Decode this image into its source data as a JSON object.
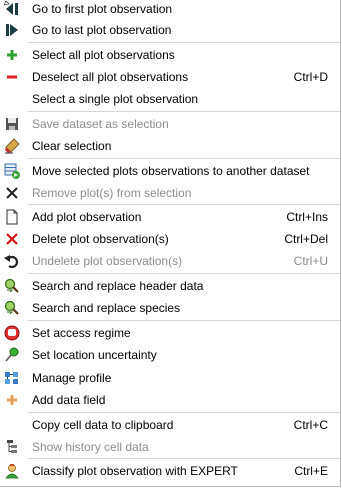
{
  "menu": {
    "items": [
      {
        "label": "Go to first plot observation",
        "shortcut": "",
        "enabled": true,
        "icon": "first-record-icon"
      },
      {
        "label": "Go to last plot observation",
        "shortcut": "",
        "enabled": true,
        "icon": "last-record-icon"
      },
      {
        "label": "Select all plot observations",
        "shortcut": "",
        "enabled": true,
        "icon": "plus-icon"
      },
      {
        "label": "Deselect all plot observations",
        "shortcut": "Ctrl+D",
        "enabled": true,
        "icon": "minus-icon"
      },
      {
        "label": "Select a single plot observation",
        "shortcut": "",
        "enabled": true,
        "icon": ""
      },
      {
        "label": "Save dataset as selection",
        "shortcut": "",
        "enabled": false,
        "icon": "save-icon"
      },
      {
        "label": "Clear selection",
        "shortcut": "",
        "enabled": true,
        "icon": "eraser-icon"
      },
      {
        "label": "Move selected plots observations to another dataset",
        "shortcut": "",
        "enabled": true,
        "icon": "move-dataset-icon"
      },
      {
        "label": "Remove plot(s) from selection",
        "shortcut": "",
        "enabled": false,
        "icon": "remove-x-icon"
      },
      {
        "label": "Add plot observation",
        "shortcut": "Ctrl+Ins",
        "enabled": true,
        "icon": "new-document-icon"
      },
      {
        "label": "Delete plot observation(s)",
        "shortcut": "Ctrl+Del",
        "enabled": true,
        "icon": "delete-x-icon"
      },
      {
        "label": "Undelete plot observation(s)",
        "shortcut": "Ctrl+U",
        "enabled": false,
        "icon": "undo-icon"
      },
      {
        "label": "Search and replace header data",
        "shortcut": "",
        "enabled": true,
        "icon": "search-replace-icon"
      },
      {
        "label": "Search and replace species",
        "shortcut": "",
        "enabled": true,
        "icon": "search-replace-icon"
      },
      {
        "label": "Set access regime",
        "shortcut": "",
        "enabled": true,
        "icon": "stop-icon"
      },
      {
        "label": "Set location uncertainty",
        "shortcut": "",
        "enabled": true,
        "icon": "pushpin-icon"
      },
      {
        "label": "Manage profile",
        "shortcut": "",
        "enabled": true,
        "icon": "profile-icon"
      },
      {
        "label": "Add data field",
        "shortcut": "",
        "enabled": true,
        "icon": "add-field-icon"
      },
      {
        "label": "Copy cell data to clipboard",
        "shortcut": "Ctrl+C",
        "enabled": true,
        "icon": ""
      },
      {
        "label": "Show history cell data",
        "shortcut": "",
        "enabled": false,
        "icon": "history-tree-icon"
      },
      {
        "label": "Classify plot observation with EXPERT",
        "shortcut": "Ctrl+E",
        "enabled": true,
        "icon": "expert-icon"
      }
    ]
  }
}
